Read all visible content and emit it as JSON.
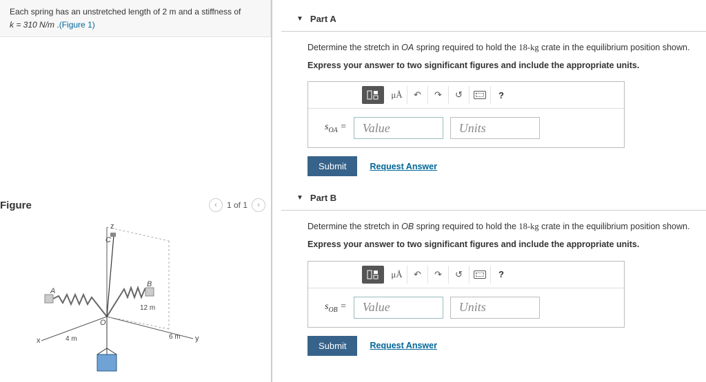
{
  "problem": {
    "intro_a": "Each spring has an unstretched length of ",
    "length": "2 m",
    "intro_b": " and a stiffness of",
    "stiff_lhs": "k = 310 N/m",
    "figref_label": "(Figure 1)"
  },
  "figure": {
    "title": "Figure",
    "pager": "1 of 1",
    "labels": {
      "z": "z",
      "C": "C",
      "A": "A",
      "B": "B",
      "O": "O",
      "x": "x",
      "y": "y",
      "d12": "12 m",
      "d6": "6 m",
      "d4": "4 m"
    }
  },
  "parts": {
    "A": {
      "title": "Part A",
      "prompt_pre": "Determine the stretch in ",
      "spring": "OA",
      "prompt_mid": " spring required to hold the ",
      "mass": "18-kg",
      "prompt_post": " crate in the equilibrium position shown.",
      "instruction": "Express your answer to two significant figures and include the appropriate units.",
      "lhs": "s",
      "sub": "OA",
      "eq": " =",
      "value_ph": "Value",
      "units_ph": "Units",
      "submit": "Submit",
      "request": "Request Answer"
    },
    "B": {
      "title": "Part B",
      "prompt_pre": "Determine the stretch in ",
      "spring": "OB",
      "prompt_mid": " spring required to hold the ",
      "mass": "18-kg",
      "prompt_post": " crate in the equilibrium position shown.",
      "instruction": "Express your answer to two significant figures and include the appropriate units.",
      "lhs": "s",
      "sub": "OB",
      "eq": " =",
      "value_ph": "Value",
      "units_ph": "Units",
      "submit": "Submit",
      "request": "Request Answer"
    }
  },
  "toolbar": {
    "mu": "μÅ",
    "help": "?"
  }
}
